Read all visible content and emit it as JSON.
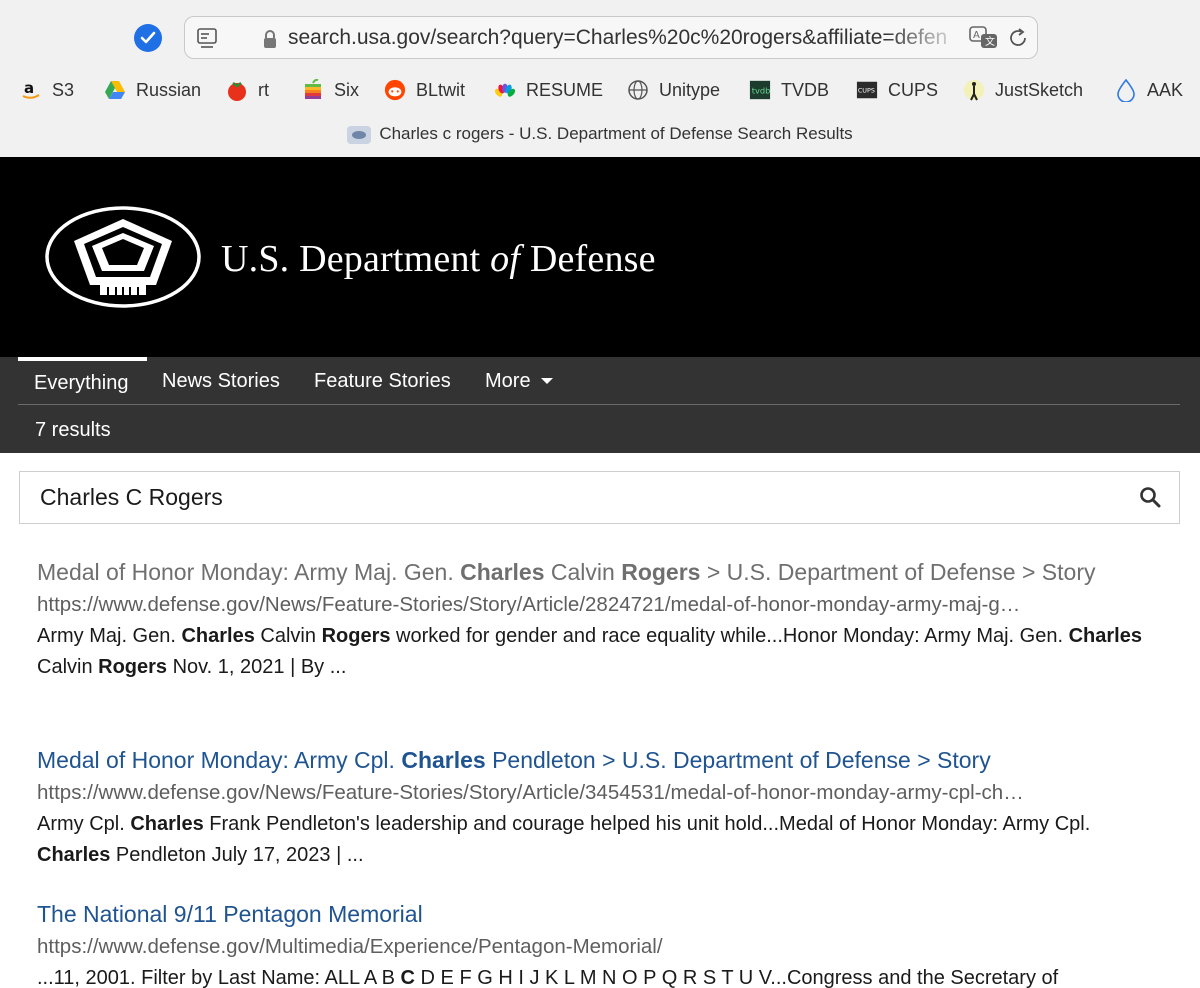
{
  "browser": {
    "url": "search.usa.gov/search?query=Charles%20c%20rogers&affiliate=defen",
    "tab_title": "Charles c rogers - U.S. Department of Defense Search Results",
    "bookmarks": [
      {
        "label": "S3",
        "icon": "amazon-icon"
      },
      {
        "label": "Russian",
        "icon": "google-drive-icon"
      },
      {
        "label": "rt",
        "icon": "tomato-icon"
      },
      {
        "label": "Six",
        "icon": "apple-rainbow-icon"
      },
      {
        "label": "BLtwit",
        "icon": "reddit-icon"
      },
      {
        "label": "RESUME",
        "icon": "nbc-peacock-icon"
      },
      {
        "label": "Unitype",
        "icon": "globe-icon"
      },
      {
        "label": "TVDB",
        "icon": "tvdb-icon"
      },
      {
        "label": "CUPS",
        "icon": "cups-icon"
      },
      {
        "label": "JustSketch",
        "icon": "sketch-figure-icon"
      },
      {
        "label": "AAK",
        "icon": "droplet-icon"
      }
    ]
  },
  "header": {
    "title_part1": "U.S. Department ",
    "title_italic": "of",
    "title_part2": " Defense"
  },
  "nav": {
    "tabs": [
      {
        "label": "Everything",
        "active": true
      },
      {
        "label": "News Stories"
      },
      {
        "label": "Feature Stories"
      },
      {
        "label": "More"
      }
    ],
    "result_count": "7 results"
  },
  "search": {
    "value": "Charles C Rogers"
  },
  "results": [
    {
      "title_segments": [
        {
          "text": "Medal of Honor Monday: Army Maj. Gen. ",
          "bold": false
        },
        {
          "text": "Charles",
          "bold": true
        },
        {
          "text": " Calvin ",
          "bold": false
        },
        {
          "text": "Rogers",
          "bold": true
        },
        {
          "text": " > U.S. Department of Defense > Story",
          "bold": false
        }
      ],
      "visited": true,
      "url": "https://www.defense.gov/News/Feature-Stories/Story/Article/2824721/medal-of-honor-monday-army-maj-g…",
      "snippet_segments": [
        {
          "text": "Army Maj. Gen. ",
          "bold": false
        },
        {
          "text": "Charles",
          "bold": true
        },
        {
          "text": " Calvin ",
          "bold": false
        },
        {
          "text": "Rogers",
          "bold": true
        },
        {
          "text": " worked for gender and race equality while...Honor Monday: Army Maj. Gen. ",
          "bold": false
        },
        {
          "text": "Charles",
          "bold": true
        },
        {
          "text": " Calvin ",
          "bold": false
        },
        {
          "text": "Rogers",
          "bold": true
        },
        {
          "text": " Nov. 1, 2021 | By ...",
          "bold": false
        }
      ]
    },
    {
      "title_segments": [
        {
          "text": "Medal of Honor Monday: Army Cpl. ",
          "bold": false
        },
        {
          "text": "Charles",
          "bold": true
        },
        {
          "text": " Pendleton > U.S. Department of Defense > Story",
          "bold": false
        }
      ],
      "visited": false,
      "url": "https://www.defense.gov/News/Feature-Stories/Story/Article/3454531/medal-of-honor-monday-army-cpl-ch…",
      "snippet_segments": [
        {
          "text": "Army Cpl. ",
          "bold": false
        },
        {
          "text": "Charles",
          "bold": true
        },
        {
          "text": " Frank Pendleton's leadership and courage helped his unit hold...Medal of Honor Monday: Army Cpl. ",
          "bold": false
        },
        {
          "text": "Charles",
          "bold": true
        },
        {
          "text": " Pendleton July 17, 2023 | ...",
          "bold": false
        }
      ]
    },
    {
      "title_segments": [
        {
          "text": "The National 9/11 Pentagon Memorial",
          "bold": false
        }
      ],
      "visited": false,
      "url": "https://www.defense.gov/Multimedia/Experience/Pentagon-Memorial/",
      "snippet_segments": [
        {
          "text": "...11, 2001. Filter by Last Name: ALL A B ",
          "bold": false
        },
        {
          "text": "C",
          "bold": true
        },
        {
          "text": " D E F G H I J K L M N O P Q R S T U V...Congress and the Secretary of",
          "bold": false
        }
      ]
    }
  ],
  "colors": {
    "link": "#1f5491",
    "visited_link": "#6f6f6f",
    "nav_bg": "#333333",
    "header_bg": "#000000",
    "check_blue": "#1f6fe5"
  }
}
